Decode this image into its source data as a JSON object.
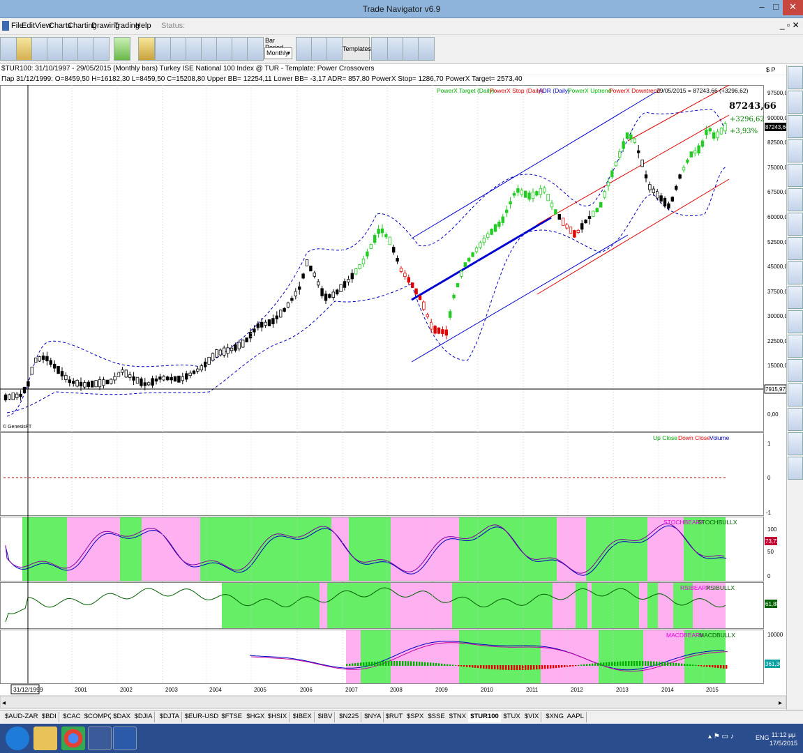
{
  "window": {
    "title": "Trade Navigator v6.9",
    "status_label": "Status:"
  },
  "menu": [
    "File",
    "Edit",
    "View",
    "Charts",
    "Charting",
    "Drawing",
    "Trading",
    "Help"
  ],
  "toolbar": {
    "bar_period_label": "Bar Period",
    "bar_period_value": "Monthly",
    "templates_label": "Templates"
  },
  "info": {
    "line1": "$TUR100: 31/10/1997 - 29/05/2015 (Monthly bars) Turkey ISE National 100 Index @ TUR - Template: Power Crossovers",
    "line2": "Пар 31/12/1999: O=8459,50 H=16182,30 L=8459,50 C=15208,80 Upper BB= 12254,11 Lower BB= -3,17 ADR= 857,80 PowerX Stop= 1286,70 PowerX Target= 2573,40",
    "sp": "$ P"
  },
  "legend_top": [
    {
      "text": "PowerX Target (Daily)",
      "color": "#00b000"
    },
    {
      "text": "PowerX Stop (Daily)",
      "color": "#e00000"
    },
    {
      "text": "ADR (Daily)",
      "color": "#0000c0"
    },
    {
      "text": "PowerX Uptrend",
      "color": "#00c000"
    },
    {
      "text": "PowerX Downtrend",
      "color": "#e00000"
    }
  ],
  "last_bar": {
    "text": "29/05/2015 = 87243,66 (+3296,62)",
    "big": "87243,66",
    "change": "+3296,62",
    "pct": "+3,93%"
  },
  "price_axis": [
    "97500,0",
    "90000,0",
    "82500,0",
    "75000,0",
    "67500,0",
    "60000,0",
    "52500,0",
    "45000,0",
    "37500,0",
    "30000,0",
    "22500,0",
    "15000,0",
    "0,00"
  ],
  "price_badges": {
    "current": "87243,66",
    "hline": "7915,97"
  },
  "genesis": "© GenesisFT",
  "volume_panel": {
    "legend": [
      {
        "text": "Up Close",
        "color": "#00a000"
      },
      {
        "text": "Down Close",
        "color": "#e00000"
      },
      {
        "text": "Volume",
        "color": "#0000c0"
      }
    ],
    "axis": [
      "1",
      "0",
      "-1"
    ]
  },
  "stoch_panel": {
    "legend": [
      {
        "text": "STOCHBEARX",
        "color": "#e000e0"
      },
      {
        "text": "STOCHBULLX",
        "color": "#006000"
      }
    ],
    "axis": [
      "100",
      "50",
      "0"
    ],
    "badge": "73,72"
  },
  "rsi_panel": {
    "legend": [
      {
        "text": "RSIBEARX",
        "color": "#e000e0"
      },
      {
        "text": "RSIBULLX",
        "color": "#006000"
      }
    ],
    "badge": "61,88"
  },
  "macd_panel": {
    "legend": [
      {
        "text": "MACDBEARX",
        "color": "#e000e0"
      },
      {
        "text": "MACDBULLX",
        "color": "#006000"
      }
    ],
    "axis": [
      "10000"
    ],
    "badge": "361,36"
  },
  "x_axis": {
    "cursor": "31/12/1999",
    "years": [
      "2001",
      "2002",
      "2003",
      "2004",
      "2005",
      "2006",
      "2007",
      "2008",
      "2009",
      "2010",
      "2011",
      "2012",
      "2013",
      "2014",
      "2015"
    ]
  },
  "tabs": [
    "$AUD-ZAR",
    "$BDI",
    "$CAC",
    "$COMPQ",
    "$DAX",
    "$DJIA",
    "$DJTA",
    "$EUR-USD",
    "$FTSE",
    "$HGX",
    "$HSIX",
    "$IBEX",
    "$IBV",
    "$N225",
    "$NYA",
    "$RUT",
    "$SPX",
    "$SSE",
    "$TNX",
    "$TUR100",
    "$TUX",
    "$VIX",
    "$XNG",
    "AAPL"
  ],
  "active_tab": "$TUR100",
  "tray": {
    "lang": "ENG",
    "time": "11:12 μμ",
    "date": "17/5/2015"
  }
}
